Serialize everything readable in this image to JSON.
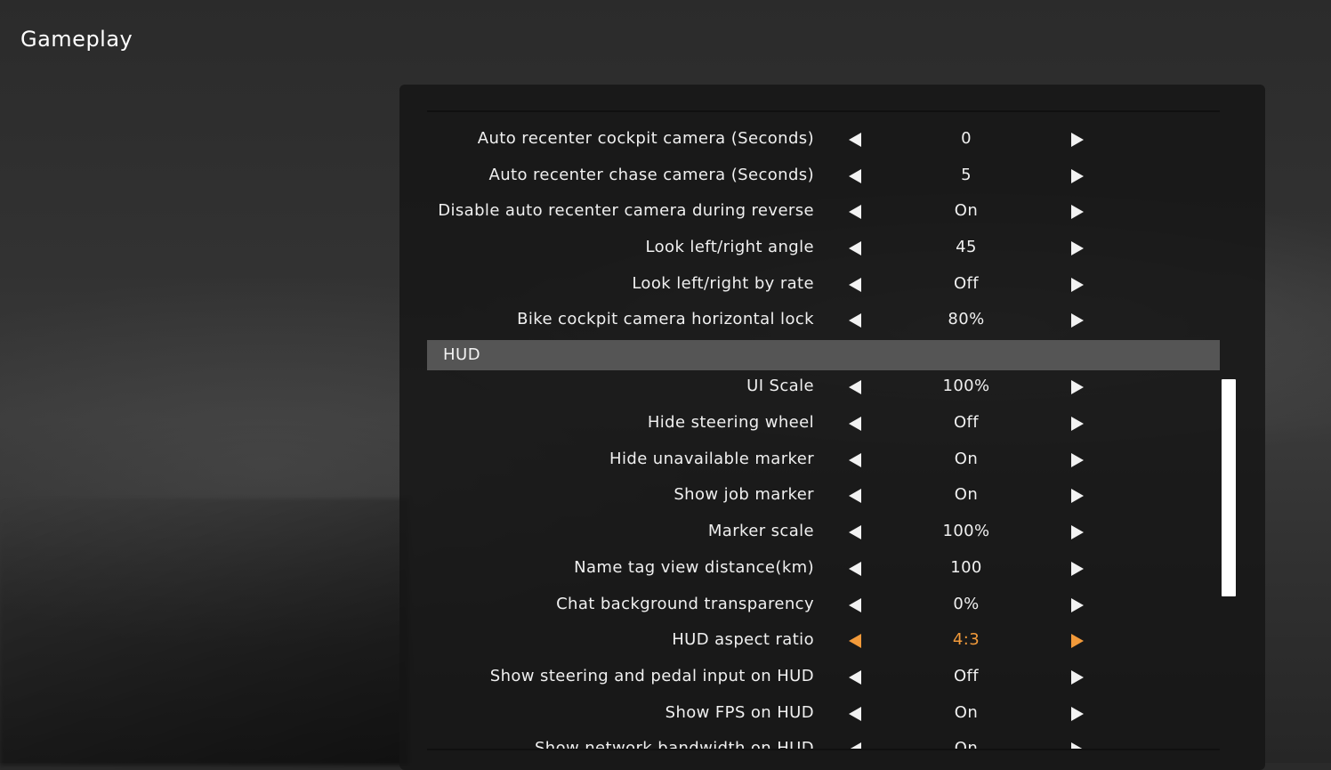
{
  "page": {
    "title": "Gameplay"
  },
  "rows_top": [
    {
      "label": "Auto recenter cockpit camera (Seconds)",
      "value": "0"
    },
    {
      "label": "Auto recenter chase camera (Seconds)",
      "value": "5"
    },
    {
      "label": "Disable auto recenter camera during reverse",
      "value": "On"
    },
    {
      "label": "Look left/right angle",
      "value": "45"
    },
    {
      "label": "Look left/right by rate",
      "value": "Off"
    },
    {
      "label": "Bike cockpit camera horizontal lock",
      "value": "80%"
    }
  ],
  "section": {
    "label": "HUD"
  },
  "rows_hud": [
    {
      "label": "UI Scale",
      "value": "100%"
    },
    {
      "label": "Hide steering wheel",
      "value": "Off"
    },
    {
      "label": "Hide unavailable marker",
      "value": "On"
    },
    {
      "label": "Show job marker",
      "value": "On"
    },
    {
      "label": "Marker scale",
      "value": "100%"
    },
    {
      "label": "Name tag view distance(km)",
      "value": "100"
    },
    {
      "label": "Chat background transparency",
      "value": "0%"
    },
    {
      "label": "HUD aspect ratio",
      "value": "4:3",
      "active": true
    },
    {
      "label": "Show steering and pedal input on HUD",
      "value": "Off"
    },
    {
      "label": "Show FPS on HUD",
      "value": "On"
    },
    {
      "label": "Show network bandwidth on HUD",
      "value": "On"
    }
  ],
  "colors": {
    "accent": "#f29a3a",
    "section_bg": "#555555",
    "panel_bg": "#161616",
    "text": "#f0f0f0"
  },
  "icons": {
    "decrease": "left-arrow-icon",
    "increase": "right-arrow-icon"
  }
}
